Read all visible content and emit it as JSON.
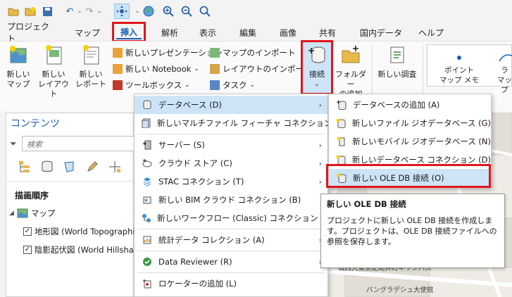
{
  "quick_access": {
    "icons": [
      "open-folder-icon",
      "save-icon",
      "print-icon",
      "undo-icon",
      "redo-icon",
      "customize-icon",
      "navigate-icon",
      "globe-icon",
      "zoom-in-icon",
      "zoom-out-icon"
    ]
  },
  "tabs": [
    "プロジェクト",
    "マップ",
    "挿入",
    "解析",
    "表示",
    "編集",
    "画像",
    "共有",
    "国内データ",
    "ヘルプ"
  ],
  "ribbon": {
    "new_map": "新しい\nマップ",
    "new_layout": "新しい\nレイアウト",
    "new_report": "新しい\nレポート",
    "new_presentation": "新しいプレゼンテーション",
    "new_notebook": "新しい Notebook",
    "toolbox": "ツールボックス",
    "import_map": "マップのインポート",
    "import_layout": "レイアウトのインポート",
    "task": "タスク",
    "connect": "接続",
    "add_folder": "フォルダー\nの追加",
    "new_survey": "新しい調査",
    "point_map_note": "ポイント\nマップ メモ",
    "right_edge_top": "ラ",
    "right_edge_bottom": "マップ"
  },
  "contents": {
    "title": "コンテンツ",
    "search_placeholder": "検索",
    "draw_order": "描画順序",
    "map": "マップ",
    "layers": [
      "地形図 (World Topographi",
      "陰影起伏図 (World Hillsha"
    ]
  },
  "menu_main": [
    {
      "label": "データベース (D)",
      "icon": "database-icon",
      "arrow": true
    },
    {
      "label": "新しいマルチファイル フィーチャ コネクション (N)",
      "icon": "multifile-icon",
      "arrow": false
    },
    {
      "label": "サーバー (S)",
      "icon": "server-icon",
      "arrow": true
    },
    {
      "label": "クラウド ストア (C)",
      "icon": "cloud-icon",
      "arrow": true
    },
    {
      "label": "STAC コネクション (T)",
      "icon": "stac-icon",
      "arrow": true
    },
    {
      "label": "新しい BIM クラウド コネクション (B)",
      "icon": "bim-icon",
      "arrow": false
    },
    {
      "label": "新しいワークフロー (Classic) コネクション (W)",
      "icon": "workflow-icon",
      "arrow": false
    },
    {
      "label": "統計データ コレクション (A)",
      "icon": "statistics-icon",
      "arrow": true
    },
    {
      "label": "Data Reviewer (R)",
      "icon": "reviewer-icon",
      "arrow": true
    },
    {
      "label": "ロケーターの追加 (L)",
      "icon": "locator-icon",
      "arrow": false
    }
  ],
  "menu_sub": [
    {
      "label": "データベースの追加 (A)",
      "icon": "add-database-icon"
    },
    {
      "label": "新しいファイル ジオデータベース (G)",
      "icon": "file-gdb-icon"
    },
    {
      "label": "新しいモバイル ジオデータベース (N)",
      "icon": "mobile-gdb-icon"
    },
    {
      "label": "新しいデータベース コネクション (D)",
      "icon": "db-connection-icon"
    },
    {
      "label": "新しい OLE DB 接続 (O)",
      "icon": "oledb-icon"
    }
  ],
  "tooltip": {
    "title": "新しい OLE DB 接続",
    "body": "プロジェクトに新しい OLE DB 接続を作成します。プロジェクトは、OLE DB 接続ファイルへの参照を保存します。"
  },
  "map_labels": [
    "城西大東京紀尾井町キャンパス",
    "バングラデシュ大使館"
  ],
  "colors": {
    "accent": "#1b5fb5",
    "highlight": "#cde4f7",
    "callout": "#e0161f"
  }
}
